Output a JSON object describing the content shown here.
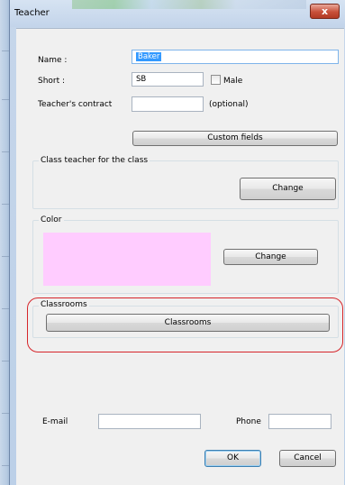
{
  "window": {
    "title": "Teacher",
    "close_label": "x"
  },
  "form": {
    "name_label": "Name :",
    "name_value": "Baker",
    "short_label": "Short :",
    "short_value": "SB",
    "male_label": "Male",
    "male_checked": false,
    "contract_label": "Teacher's contract",
    "contract_value": "",
    "contract_hint": "(optional)",
    "custom_fields_label": "Custom fields"
  },
  "class_teacher": {
    "title": "Class teacher for the class",
    "change_label": "Change"
  },
  "color": {
    "title": "Color",
    "swatch_color": "#ffccff",
    "change_label": "Change"
  },
  "classrooms": {
    "title": "Classrooms",
    "button_label": "Classrooms",
    "highlight_color": "#d6262b"
  },
  "contact": {
    "email_label": "E-mail",
    "email_value": "",
    "phone_label": "Phone",
    "phone_value": ""
  },
  "footer": {
    "ok_label": "OK",
    "cancel_label": "Cancel"
  }
}
